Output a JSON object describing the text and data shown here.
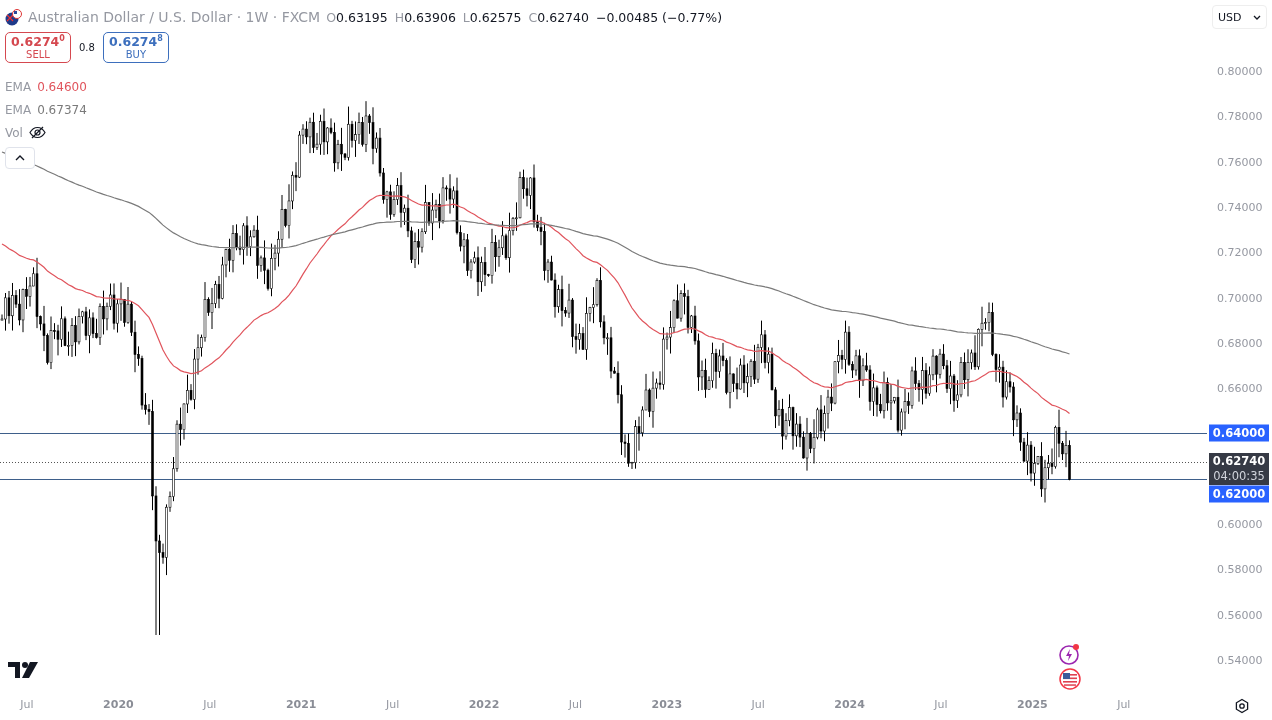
{
  "header": {
    "title": "Australian Dollar / U.S. Dollar · 1W · FXCM",
    "ohlc": [
      {
        "label": "O",
        "value": "0.63195"
      },
      {
        "label": "H",
        "value": "0.63906"
      },
      {
        "label": "L",
        "value": "0.62575"
      },
      {
        "label": "C",
        "value": "0.62740"
      }
    ],
    "change": "−0.00485 (−0.77%)"
  },
  "trade": {
    "sell": {
      "price": "0.6274$^{0}$",
      "label": "SELL"
    },
    "spread": "0.8",
    "buy": {
      "price": "0.6274$^{8}$",
      "label": "BUY"
    }
  },
  "indicators": [
    {
      "kind": "ema",
      "name": "EMA",
      "value": "0.64600",
      "color": "#e0545c"
    },
    {
      "kind": "ema",
      "name": "EMA",
      "value": "0.67374",
      "color": "#7a7a7a"
    },
    {
      "kind": "volume",
      "name": "Vol",
      "hidden": true
    }
  ],
  "currency": "USD",
  "price_axis": {
    "ticks": [
      "0.80000",
      "0.78000",
      "0.76000",
      "0.74000",
      "0.72000",
      "0.70000",
      "0.68000",
      "0.66000",
      "0.60000",
      "0.58000",
      "0.56000",
      "0.54000"
    ]
  },
  "price_labels": [
    {
      "kind": "level",
      "value": "0.64000"
    },
    {
      "kind": "current",
      "value": "0.62740",
      "countdown": "04:00:35"
    },
    {
      "kind": "level",
      "value": "0.62000"
    }
  ],
  "time_axis": [
    "Jul",
    "2020",
    "Jul",
    "2021",
    "Jul",
    "2022",
    "Jul",
    "2023",
    "Jul",
    "2024",
    "Jul",
    "2025",
    "Jul"
  ]
}
